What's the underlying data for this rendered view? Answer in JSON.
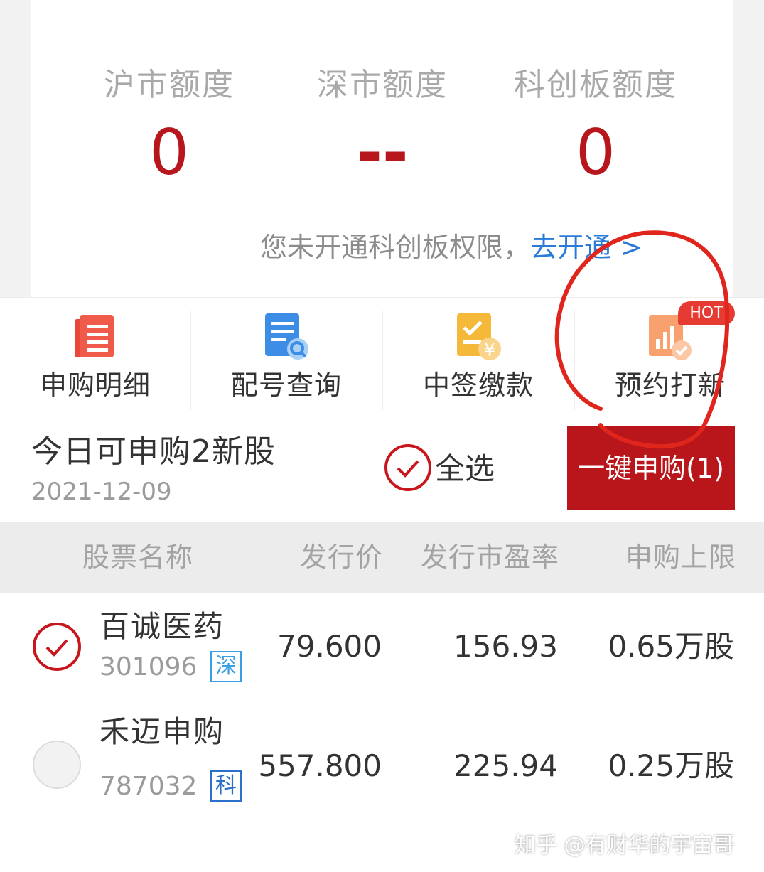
{
  "quotas": [
    {
      "label": "沪市额度",
      "value": "0"
    },
    {
      "label": "深市额度",
      "value": "--"
    },
    {
      "label": "科创板额度",
      "value": "0"
    }
  ],
  "notice": {
    "text": "您未开通科创板权限，",
    "link": "去开通 >"
  },
  "shortcuts": [
    {
      "label": "申购明细",
      "icon": "list-icon"
    },
    {
      "label": "配号查询",
      "icon": "search-document-icon"
    },
    {
      "label": "中签缴款",
      "icon": "payment-document-icon"
    },
    {
      "label": "预约打新",
      "icon": "chart-check-icon",
      "badge": "HOT"
    }
  ],
  "today": {
    "title": "今日可申购2新股",
    "date": "2021-12-09",
    "select_all": "全选",
    "one_key_button": "一键申购(1)"
  },
  "table": {
    "headers": [
      "股票名称",
      "发行价",
      "发行市盈率",
      "申购上限"
    ],
    "rows": [
      {
        "name": "百诚医药",
        "code": "301096",
        "market": "深",
        "price": "79.600",
        "pe": "156.93",
        "limit": "0.65万股",
        "selected": true
      },
      {
        "name": "禾迈申购",
        "code": "787032",
        "market": "科",
        "price": "557.800",
        "pe": "225.94",
        "limit": "0.25万股",
        "selected": false
      }
    ]
  },
  "watermark": "知乎 @有财华的宇宙哥",
  "colors": {
    "accent_red": "#b8161b",
    "link_blue": "#2a7ad8",
    "annotation_red": "#e0261c"
  }
}
